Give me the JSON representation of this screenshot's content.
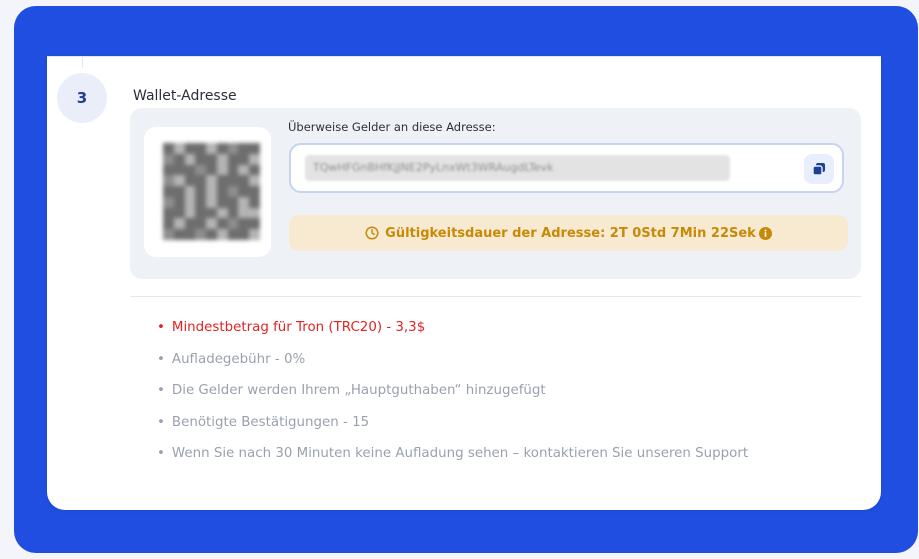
{
  "step": {
    "number": "3",
    "title": "Wallet-Adresse"
  },
  "wallet": {
    "qr_code": "qr-code-image",
    "address_label": "Überweise Gelder an diese Adresse:",
    "address_value": "TQwHFGnBHfKjJNE2PyLnxWt3WRAugdLTevk",
    "copy_icon": "copy-icon",
    "validity_text": "Gültigkeitsdauer der Adresse: 2T 0Std 7Min 22Sek",
    "validity_icons": [
      "clock-icon",
      "info-icon"
    ]
  },
  "notes": [
    {
      "text": "Mindestbetrag für Tron (TRC20) - 3,3$",
      "highlight": true
    },
    {
      "text": "Aufladegebühr - 0%",
      "highlight": false
    },
    {
      "text": "Die Gelder werden Ihrem „Hauptguthaben“ hinzugefügt",
      "highlight": false
    },
    {
      "text": "Benötigte Bestätigungen - 15",
      "highlight": false
    },
    {
      "text": "Wenn Sie nach 30 Minuten keine Aufladung sehen – kontaktieren Sie unseren Support",
      "highlight": false
    }
  ],
  "colors": {
    "frame": "#1f4ee0",
    "accent": "#1d3f96",
    "warning_text": "#c78a08",
    "warning_bg": "#f7ead1",
    "error": "#e02424",
    "muted": "#9aa1ad"
  }
}
